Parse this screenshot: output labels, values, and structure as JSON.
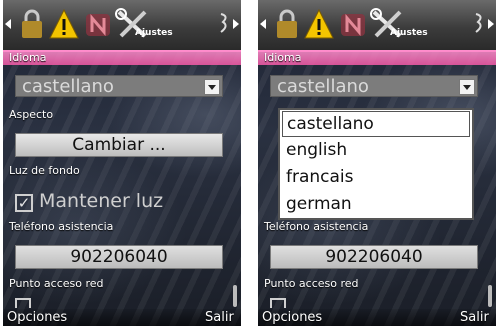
{
  "screens": [
    {
      "tab_title": "Ajustes",
      "fields": {
        "idioma_label": "Idioma",
        "idioma_value": "castellano",
        "aspecto_label": "Aspecto",
        "aspecto_button": "Cambiar ...",
        "luz_label": "Luz de fondo",
        "luz_check_text": "Mantener luz",
        "telefono_label": "Teléfono asistencia",
        "telefono_value": "902206040",
        "punto_label": "Punto acceso red"
      },
      "softkeys": {
        "left": "Opciones",
        "right": "Salir"
      }
    },
    {
      "tab_title": "Ajustes",
      "fields": {
        "idioma_label": "Idioma",
        "idioma_value": "castellano",
        "telefono_label": "Teléfono asistencia",
        "telefono_value": "902206040",
        "punto_label": "Punto acceso red"
      },
      "dropdown_options": [
        "castellano",
        "english",
        "francais",
        "german"
      ],
      "selected_option": "castellano",
      "softkeys": {
        "left": "Opciones",
        "right": "Salir"
      }
    }
  ],
  "colors": {
    "highlight": "#f55aa8"
  },
  "icons": [
    "lock-icon",
    "warning-icon",
    "n-logo-icon",
    "tools-icon"
  ]
}
